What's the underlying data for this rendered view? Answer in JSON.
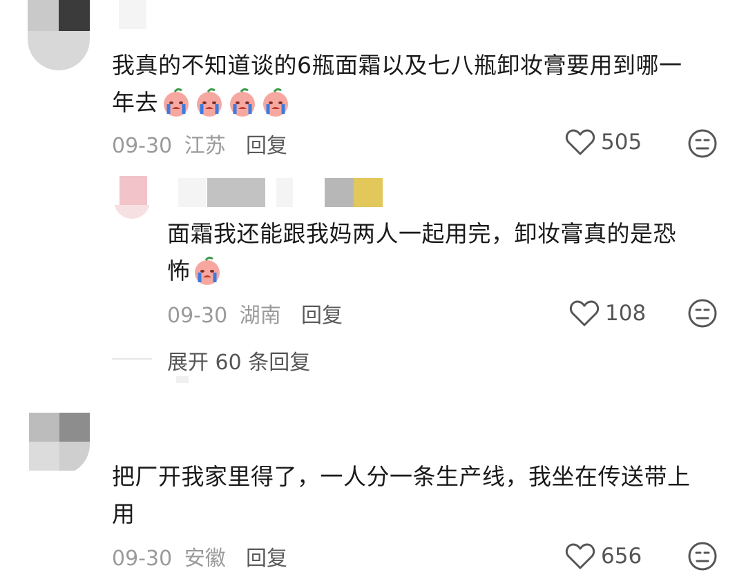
{
  "comments": [
    {
      "text_line1": "我真的不知道谈的6瓶面霜以及七八瓶卸妆膏要用到哪一",
      "text_line2": "年去",
      "date": "09-30",
      "location": "江苏",
      "reply_label": "回复",
      "likes": "505",
      "emoji_icon": "crying-peach-emoji",
      "emoji_count": 4
    },
    {
      "text_line1": "面霜我还能跟我妈两人一起用完，卸妆膏真的是恐",
      "text_line2": "怖",
      "date": "09-30",
      "location": "湖南",
      "reply_label": "回复",
      "likes": "108",
      "emoji_icon": "crying-peach-emoji",
      "emoji_count": 1
    },
    {
      "text_line1": "把厂开我家里得了，一人分一条生产线，我坐在传送带上",
      "text_line2": "用",
      "date": "09-30",
      "location": "安徽",
      "reply_label": "回复",
      "likes": "656"
    }
  ],
  "expand_replies": "展开 60 条回复",
  "icons": {
    "like": "heart-outline-icon",
    "dislike": "neutral-face-icon"
  },
  "colors": {
    "text": "#1a1a1a",
    "meta": "#9a9a9a",
    "icon": "#555555"
  }
}
